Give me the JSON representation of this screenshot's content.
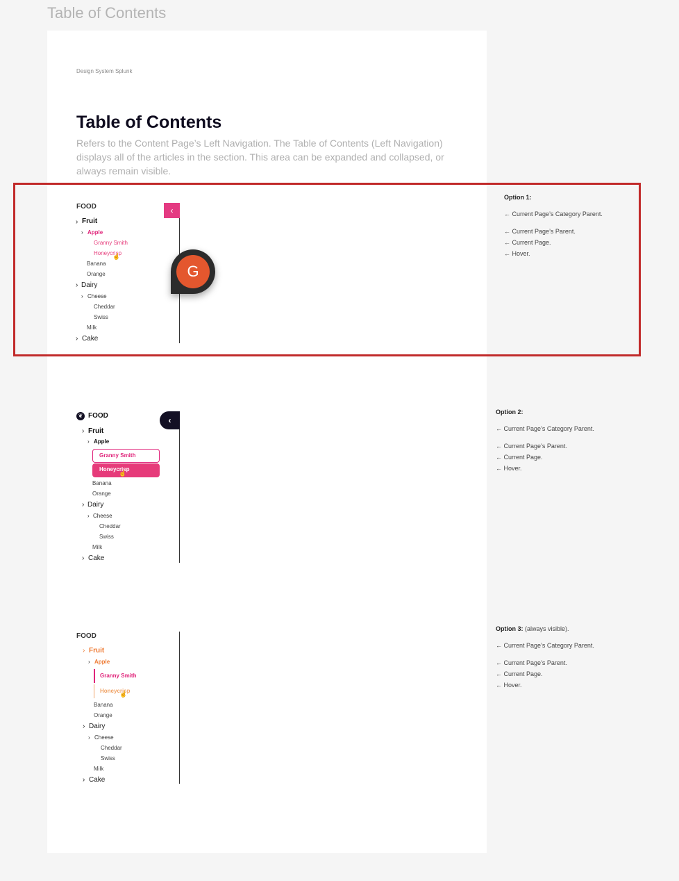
{
  "frame_title": "Table of Contents",
  "breadcrumb": "Design System Splunk",
  "page_title": "Table of Contents",
  "description": "Refers to the Content Page’s Left Navigation. The Table of Contents (Left Navigation) displays all of the articles in the section. This area can be expanded and collapsed, or always remain visible.",
  "avatar_letter": "G",
  "nav": {
    "heading": "FOOD",
    "fruit": "Fruit",
    "apple": "Apple",
    "granny_smith": "Granny Smith",
    "honeycrisp": "Honeycrisp",
    "banana": "Banana",
    "orange": "Orange",
    "dairy": "Dairy",
    "cheese": "Cheese",
    "cheddar": "Cheddar",
    "swiss": "Swiss",
    "milk": "Milk",
    "cake": "Cake",
    "chevron": "›",
    "collapse_glyph": "‹"
  },
  "options": [
    {
      "title": "Option 1:",
      "suffix": ""
    },
    {
      "title": "Option 2:",
      "suffix": ""
    },
    {
      "title": "Option 3:",
      "suffix": " (always visible)."
    }
  ],
  "notes": {
    "category_parent": "← Current Page’s Category Parent.",
    "parent": "← Current Page’s Parent.",
    "current": "← Current Page.",
    "hover": "← Hover."
  },
  "colors": {
    "accent_pink": "#e63b7a",
    "accent_orange": "#ee7a33",
    "dark": "#131024",
    "highlight_red": "#c12a2a"
  }
}
